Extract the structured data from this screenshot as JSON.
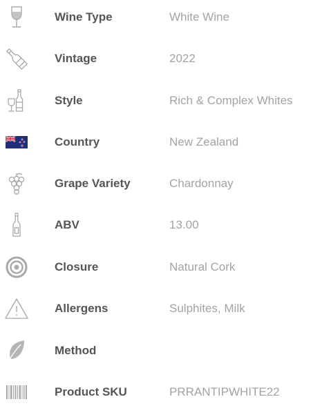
{
  "specs": [
    {
      "label": "Wine Type",
      "value": "White Wine",
      "icon": "wine-glass-icon"
    },
    {
      "label": "Vintage",
      "value": "2022",
      "icon": "bottle-icon"
    },
    {
      "label": "Style",
      "value": "Rich & Complex Whites",
      "icon": "bottle-and-glass-icon"
    },
    {
      "label": "Country",
      "value": "New Zealand",
      "icon": "new-zealand-flag-icon"
    },
    {
      "label": "Grape Variety",
      "value": "Chardonnay",
      "icon": "grapes-icon"
    },
    {
      "label": "ABV",
      "value": "13.00",
      "icon": "slim-bottle-icon"
    },
    {
      "label": "Closure",
      "value": "Natural Cork",
      "icon": "cork-target-icon"
    },
    {
      "label": "Allergens",
      "value": "Sulphites, Milk",
      "icon": "warning-triangle-icon"
    },
    {
      "label": "Method",
      "value": "",
      "icon": "leaf-icon"
    },
    {
      "label": "Product SKU",
      "value": "PRRANTIPWHITE22",
      "icon": "barcode-icon"
    }
  ],
  "colors": {
    "label": "#555555",
    "value": "#a3a3a3",
    "icon": "#a8a8a8",
    "icon_fill": "#b5b5b5"
  }
}
